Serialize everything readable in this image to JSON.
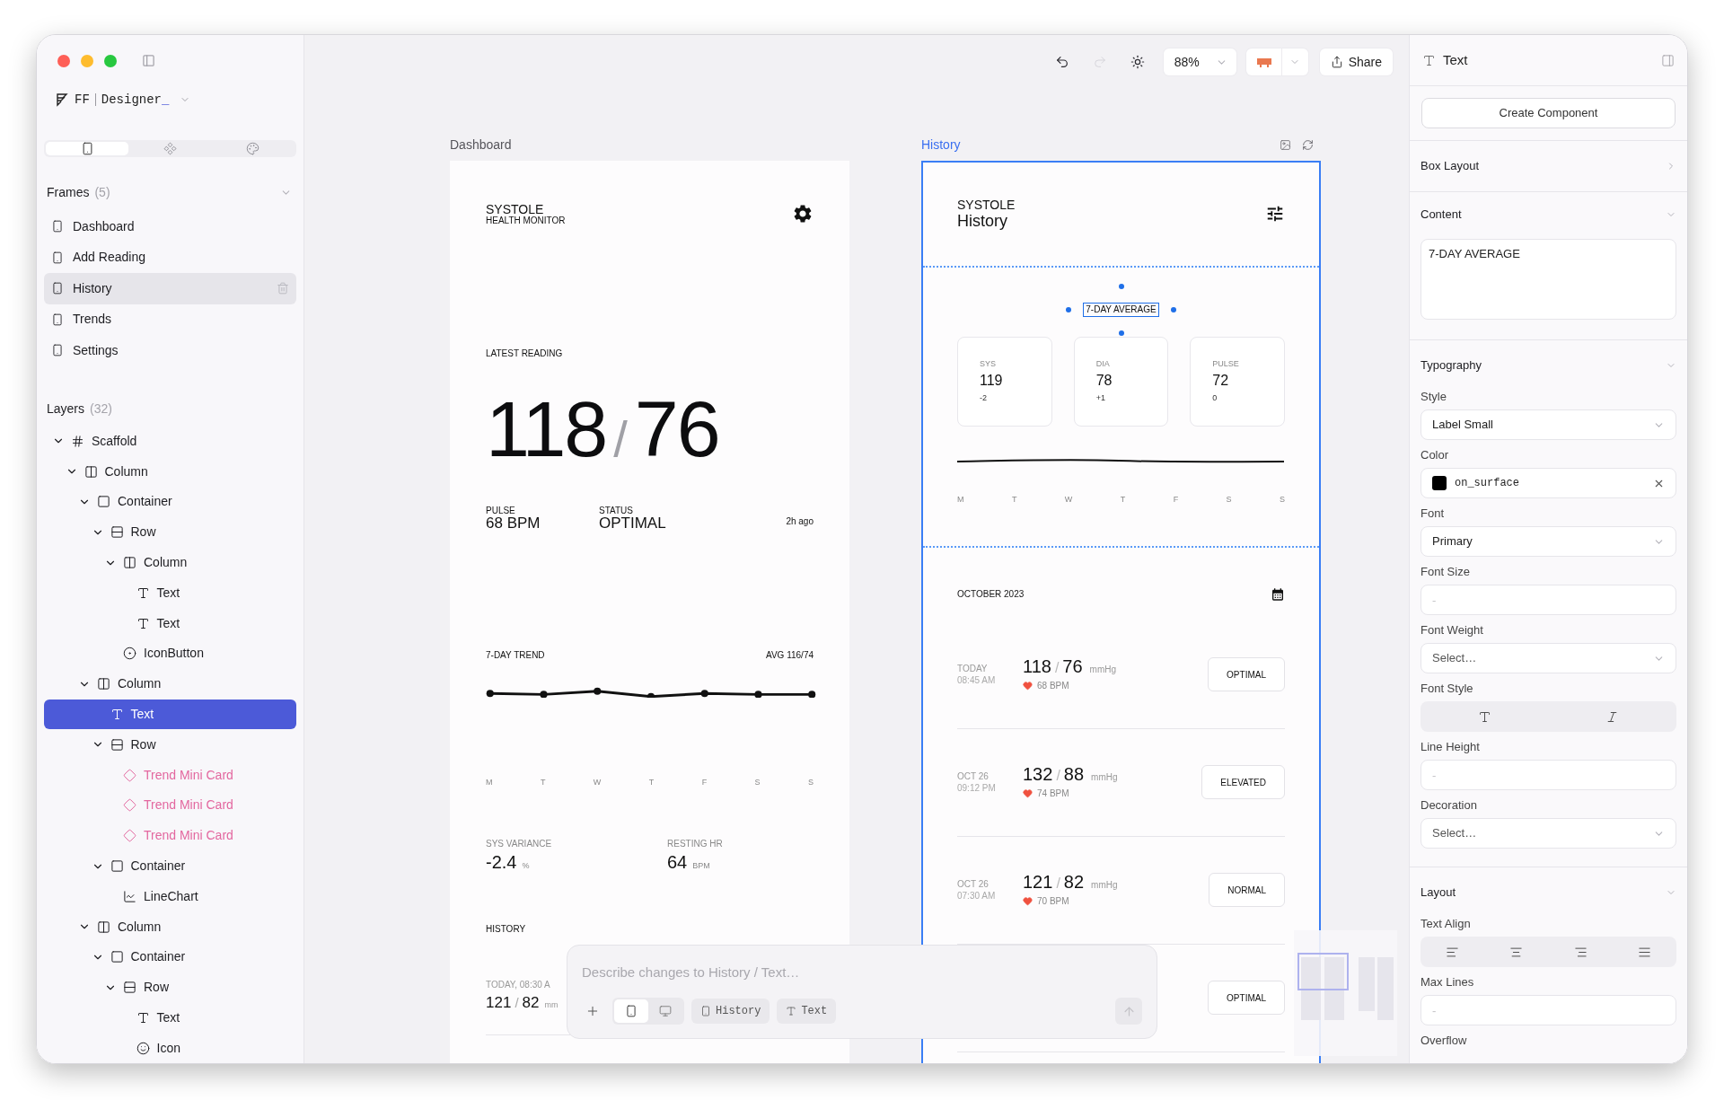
{
  "app": {
    "brand": "FF",
    "product": "Designer",
    "cursor": "_"
  },
  "sidebar": {
    "tabs": [
      {
        "kind": "frames",
        "selected": true
      },
      {
        "kind": "components",
        "selected": false
      },
      {
        "kind": "theme",
        "selected": false
      }
    ],
    "frames": {
      "title": "Frames",
      "count": "(5)",
      "items": [
        {
          "label": "Dashboard",
          "selected": false
        },
        {
          "label": "Add Reading",
          "selected": false
        },
        {
          "label": "History",
          "selected": true
        },
        {
          "label": "Trends",
          "selected": false
        },
        {
          "label": "Settings",
          "selected": false
        }
      ]
    },
    "layers": {
      "title": "Layers",
      "count": "(32)",
      "tree": [
        {
          "label": "Scaffold",
          "kind": "scaffold",
          "selected": false,
          "expanded": true,
          "children": [
            {
              "label": "Column",
              "kind": "column",
              "selected": false,
              "expanded": true,
              "children": [
                {
                  "label": "Container",
                  "kind": "container",
                  "selected": false,
                  "expanded": true,
                  "children": [
                    {
                      "label": "Row",
                      "kind": "row",
                      "selected": false,
                      "expanded": true,
                      "children": [
                        {
                          "label": "Column",
                          "kind": "column",
                          "selected": false,
                          "expanded": true,
                          "children": [
                            {
                              "label": "Text",
                              "kind": "text",
                              "selected": false
                            },
                            {
                              "label": "Text",
                              "kind": "text",
                              "selected": false
                            }
                          ]
                        },
                        {
                          "label": "IconButton",
                          "kind": "iconbutton",
                          "selected": false
                        }
                      ]
                    }
                  ]
                },
                {
                  "label": "Column",
                  "kind": "column",
                  "selected": false,
                  "expanded": true,
                  "children": [
                    {
                      "label": "Text",
                      "kind": "text",
                      "selected": true
                    },
                    {
                      "label": "Row",
                      "kind": "row",
                      "selected": false,
                      "expanded": true,
                      "children": [
                        {
                          "label": "Trend Mini Card",
                          "kind": "component",
                          "selected": false
                        },
                        {
                          "label": "Trend Mini Card",
                          "kind": "component",
                          "selected": false
                        },
                        {
                          "label": "Trend Mini Card",
                          "kind": "component",
                          "selected": false
                        }
                      ]
                    },
                    {
                      "label": "Container",
                      "kind": "container",
                      "selected": false,
                      "expanded": true,
                      "children": [
                        {
                          "label": "LineChart",
                          "kind": "chart",
                          "selected": false
                        }
                      ]
                    }
                  ]
                },
                {
                  "label": "Column",
                  "kind": "column",
                  "selected": false,
                  "expanded": true,
                  "children": [
                    {
                      "label": "Container",
                      "kind": "container",
                      "selected": false,
                      "expanded": true,
                      "children": [
                        {
                          "label": "Row",
                          "kind": "row",
                          "selected": false,
                          "expanded": true,
                          "children": [
                            {
                              "label": "Text",
                              "kind": "text",
                              "selected": false
                            },
                            {
                              "label": "Icon",
                              "kind": "icon",
                              "selected": false
                            }
                          ]
                        }
                      ]
                    }
                  ]
                }
              ]
            }
          ]
        }
      ]
    }
  },
  "toolbar": {
    "buttons": [
      {
        "kind": "undo",
        "disabled": false
      },
      {
        "kind": "redo",
        "disabled": true
      },
      {
        "kind": "theme",
        "disabled": false
      }
    ],
    "zoom": "88%",
    "share": "Share"
  },
  "dashboard": {
    "label": "Dashboard",
    "selected": false,
    "title": "SYSTOLE",
    "subtitle": "HEALTH MONITOR",
    "latest": {
      "label": "LATEST READING",
      "sys": "118",
      "separator": "/",
      "dia": "76"
    },
    "stats": [
      {
        "label": "PULSE",
        "value": "68 BPM"
      },
      {
        "label": "STATUS",
        "value": "OPTIMAL"
      }
    ],
    "updated": "2h ago",
    "trend": {
      "title": "7-DAY TREND",
      "average": "AVG 116/74",
      "days": [
        "M",
        "T",
        "W",
        "T",
        "F",
        "S",
        "S"
      ]
    },
    "metrics": [
      {
        "label": "SYS VARIANCE",
        "value": "-2.4",
        "unit": "%"
      },
      {
        "label": "RESTING HR",
        "value": "64",
        "unit": "BPM"
      }
    ],
    "history": {
      "title": "HISTORY",
      "rows": [
        {
          "date": "TODAY, 08:30 A",
          "sys": "121",
          "separator": "/",
          "dia": "82",
          "unit": "mm"
        }
      ]
    }
  },
  "history": {
    "label": "History",
    "selected": true,
    "title": "SYSTOLE",
    "subtitle": "History",
    "average": {
      "label": "7-DAY AVERAGE",
      "selected": true,
      "cards": [
        {
          "label": "SYS",
          "value": "119",
          "delta": "-2"
        },
        {
          "label": "DIA",
          "value": "78",
          "delta": "+1"
        },
        {
          "label": "PULSE",
          "value": "72",
          "delta": "0"
        }
      ],
      "days": [
        "M",
        "T",
        "W",
        "T",
        "F",
        "S",
        "S"
      ]
    },
    "month": "OCTOBER 2023",
    "readings": [
      {
        "day": "TODAY",
        "time": "08:45 AM",
        "sys": "118",
        "separator": "/",
        "dia": "76",
        "unit": "mmHg",
        "pulse": "68 BPM",
        "status": "OPTIMAL"
      },
      {
        "day": "OCT 26",
        "time": "09:12 PM",
        "sys": "132",
        "separator": "/",
        "dia": "88",
        "unit": "mmHg",
        "pulse": "74 BPM",
        "status": "ELEVATED"
      },
      {
        "day": "OCT 26",
        "time": "07:30 AM",
        "sys": "121",
        "separator": "/",
        "dia": "82",
        "unit": "mmHg",
        "pulse": "70 BPM",
        "status": "NORMAL"
      },
      {
        "status": "OPTIMAL"
      }
    ]
  },
  "prompt": {
    "placeholder": "Describe changes to History / Text…",
    "devices": [
      {
        "kind": "mobile",
        "selected": true
      },
      {
        "kind": "desktop",
        "selected": false
      }
    ],
    "chips": [
      {
        "kind": "frame",
        "label": "History"
      },
      {
        "kind": "text",
        "label": "Text"
      }
    ],
    "send_disabled": true
  },
  "inspector": {
    "title": "Text",
    "create_button": "Create Component",
    "box_layout": {
      "title": "Box Layout",
      "expanded": false
    },
    "content": {
      "title": "Content",
      "expanded": true,
      "value": "7-DAY AVERAGE"
    },
    "typography": {
      "title": "Typography",
      "expanded": true,
      "fields": [
        {
          "kind": "select",
          "label": "Style",
          "value": "Label Small"
        },
        {
          "kind": "color",
          "label": "Color",
          "value": "on_surface",
          "color": "#000000"
        },
        {
          "kind": "select",
          "label": "Font",
          "value": "Primary"
        },
        {
          "kind": "input",
          "label": "Font Size",
          "placeholder": "-"
        },
        {
          "kind": "select",
          "label": "Font Weight",
          "placeholder": "Select…"
        },
        {
          "kind": "segmented",
          "label": "Font Style",
          "options": [
            {
              "kind": "normal"
            },
            {
              "kind": "italic"
            }
          ]
        },
        {
          "kind": "input",
          "label": "Line Height",
          "placeholder": "-"
        },
        {
          "kind": "select",
          "label": "Decoration",
          "placeholder": "Select…"
        }
      ]
    },
    "layout": {
      "title": "Layout",
      "expanded": true,
      "fields": [
        {
          "kind": "segmented",
          "label": "Text Align",
          "options": [
            {
              "kind": "left"
            },
            {
              "kind": "center"
            },
            {
              "kind": "right"
            },
            {
              "kind": "justify"
            }
          ]
        },
        {
          "kind": "input",
          "label": "Max Lines",
          "placeholder": "-"
        },
        {
          "kind": "label",
          "label": "Overflow"
        }
      ]
    }
  }
}
